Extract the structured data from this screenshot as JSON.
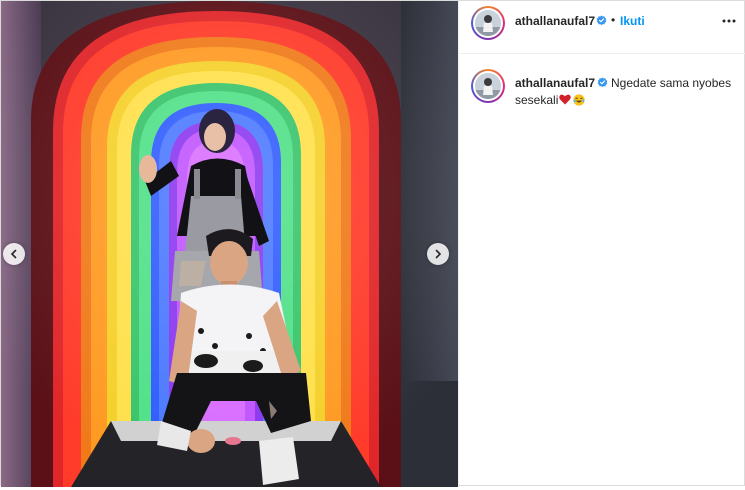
{
  "post": {
    "username": "athallanaufal7",
    "verified_icon": "verified-badge-icon",
    "separator": "•",
    "follow_label": "Ikuti",
    "more_icon": "more-options-icon",
    "caption": {
      "username": "athallanaufal7",
      "text": "Ngedate sama nyobes sesekali",
      "emojis": [
        "red-heart-emoji",
        "tears-of-joy-emoji"
      ]
    },
    "media": {
      "prev_icon": "chevron-left-icon",
      "next_icon": "chevron-right-icon"
    }
  },
  "colors": {
    "link_blue": "#0095f6",
    "verified_blue": "#3897f0",
    "border": "#dbdbdb"
  }
}
